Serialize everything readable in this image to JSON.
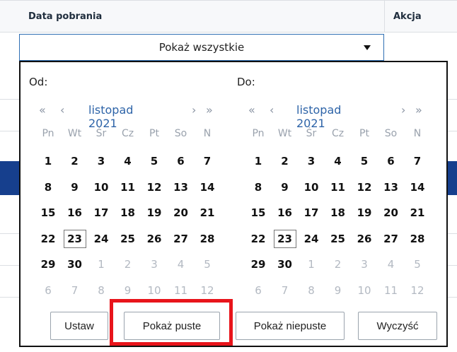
{
  "table": {
    "col_date": "Data pobrania",
    "col_action": "Akcja",
    "filter_value": "Pokaż wszystkie"
  },
  "picker": {
    "from_label": "Od:",
    "to_label": "Do:",
    "nav": {
      "prev_year": "«",
      "prev_month": "‹",
      "next_month": "›",
      "next_year": "»"
    },
    "month_left": "listopad 2021",
    "month_right": "listopad 2021",
    "weekdays": [
      "Pn",
      "Wt",
      "Śr",
      "Cz",
      "Pt",
      "So",
      "N"
    ],
    "weeks": [
      [
        [
          "1",
          1
        ],
        [
          "2",
          1
        ],
        [
          "3",
          1
        ],
        [
          "4",
          1
        ],
        [
          "5",
          1
        ],
        [
          "6",
          1
        ],
        [
          "7",
          1
        ]
      ],
      [
        [
          "8",
          1
        ],
        [
          "9",
          1
        ],
        [
          "10",
          1
        ],
        [
          "11",
          1
        ],
        [
          "12",
          1
        ],
        [
          "13",
          1
        ],
        [
          "14",
          1
        ]
      ],
      [
        [
          "15",
          1
        ],
        [
          "16",
          1
        ],
        [
          "17",
          1
        ],
        [
          "18",
          1
        ],
        [
          "19",
          1
        ],
        [
          "20",
          1
        ],
        [
          "21",
          1
        ]
      ],
      [
        [
          "22",
          1
        ],
        [
          "23",
          2
        ],
        [
          "24",
          1
        ],
        [
          "25",
          1
        ],
        [
          "26",
          1
        ],
        [
          "27",
          1
        ],
        [
          "28",
          1
        ]
      ],
      [
        [
          "29",
          1
        ],
        [
          "30",
          1
        ],
        [
          "1",
          0
        ],
        [
          "2",
          0
        ],
        [
          "3",
          0
        ],
        [
          "4",
          0
        ],
        [
          "5",
          0
        ]
      ],
      [
        [
          "6",
          0
        ],
        [
          "7",
          0
        ],
        [
          "8",
          0
        ],
        [
          "9",
          0
        ],
        [
          "10",
          0
        ],
        [
          "11",
          0
        ],
        [
          "12",
          0
        ]
      ]
    ],
    "buttons": {
      "set": "Ustaw",
      "show_empty": "Pokaż puste",
      "show_nonempty": "Pokaż niepuste",
      "clear": "Wyczyść"
    }
  },
  "colors": {
    "highlight": "#e8141b",
    "accent": "#2e64a8",
    "row_selected": "#163f8d"
  }
}
